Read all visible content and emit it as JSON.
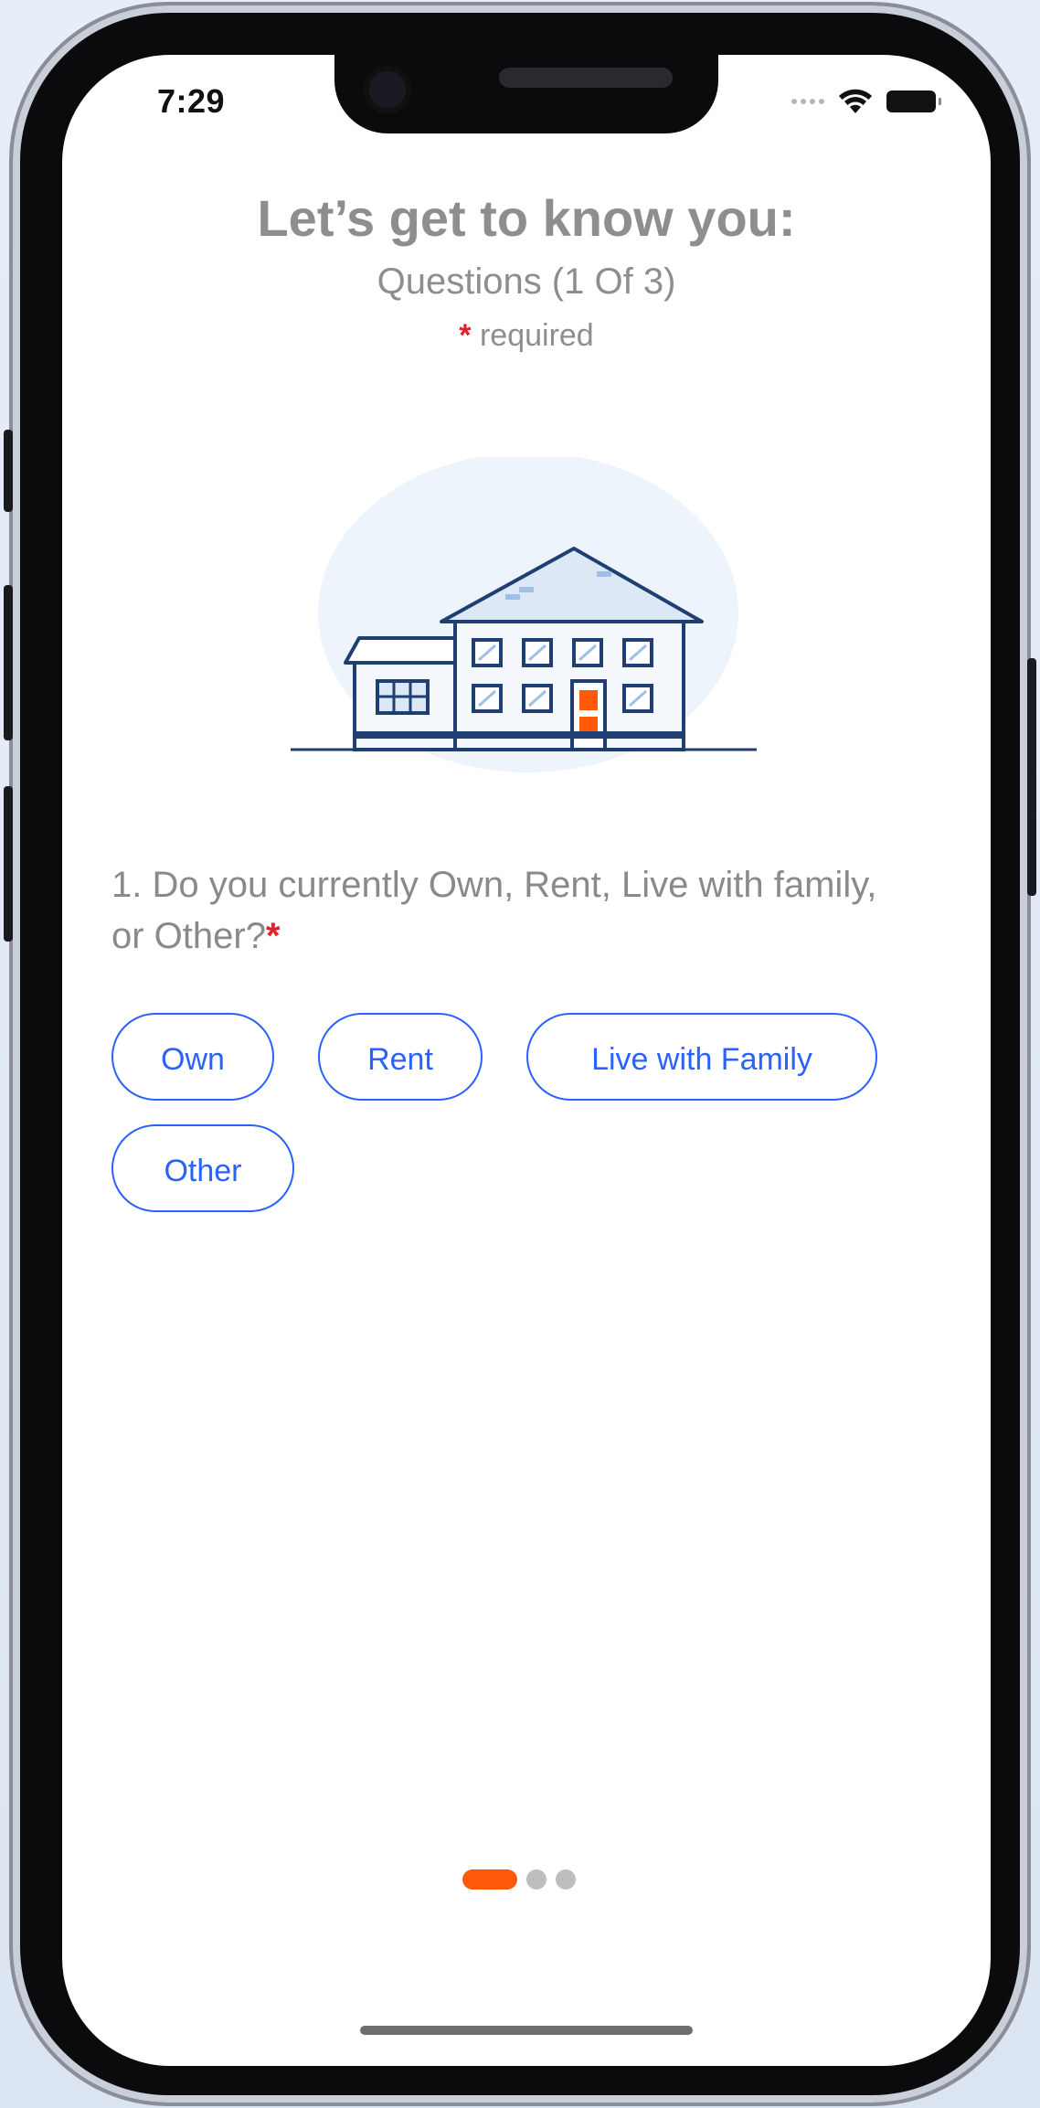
{
  "status_bar": {
    "time": "7:29",
    "wifi_icon": "wifi-icon",
    "battery_icon": "battery-icon"
  },
  "header": {
    "title": "Let’s get to know you:",
    "subtitle": "Questions (1 Of 3)",
    "required_mark": "*",
    "required_label": "required"
  },
  "illustration": {
    "name": "house-illustration",
    "colors": {
      "outline": "#1f3f73",
      "fill": "#e9f1fb",
      "door": "#ff5a0a",
      "circle": "#eef4fb"
    }
  },
  "question": {
    "text": "1. Do you currently Own, Rent, Live with family, or Other?",
    "required_mark": "*"
  },
  "options": [
    {
      "label": "Own"
    },
    {
      "label": "Rent"
    },
    {
      "label": "Live with Family"
    },
    {
      "label": "Other"
    }
  ],
  "pager": {
    "current": 1,
    "total": 3,
    "active_color": "#ff5a0a",
    "inactive_color": "#bdbdbd"
  },
  "colors": {
    "accent": "#2962ff",
    "required": "#e0202a",
    "text_muted": "#8e8e8e"
  }
}
